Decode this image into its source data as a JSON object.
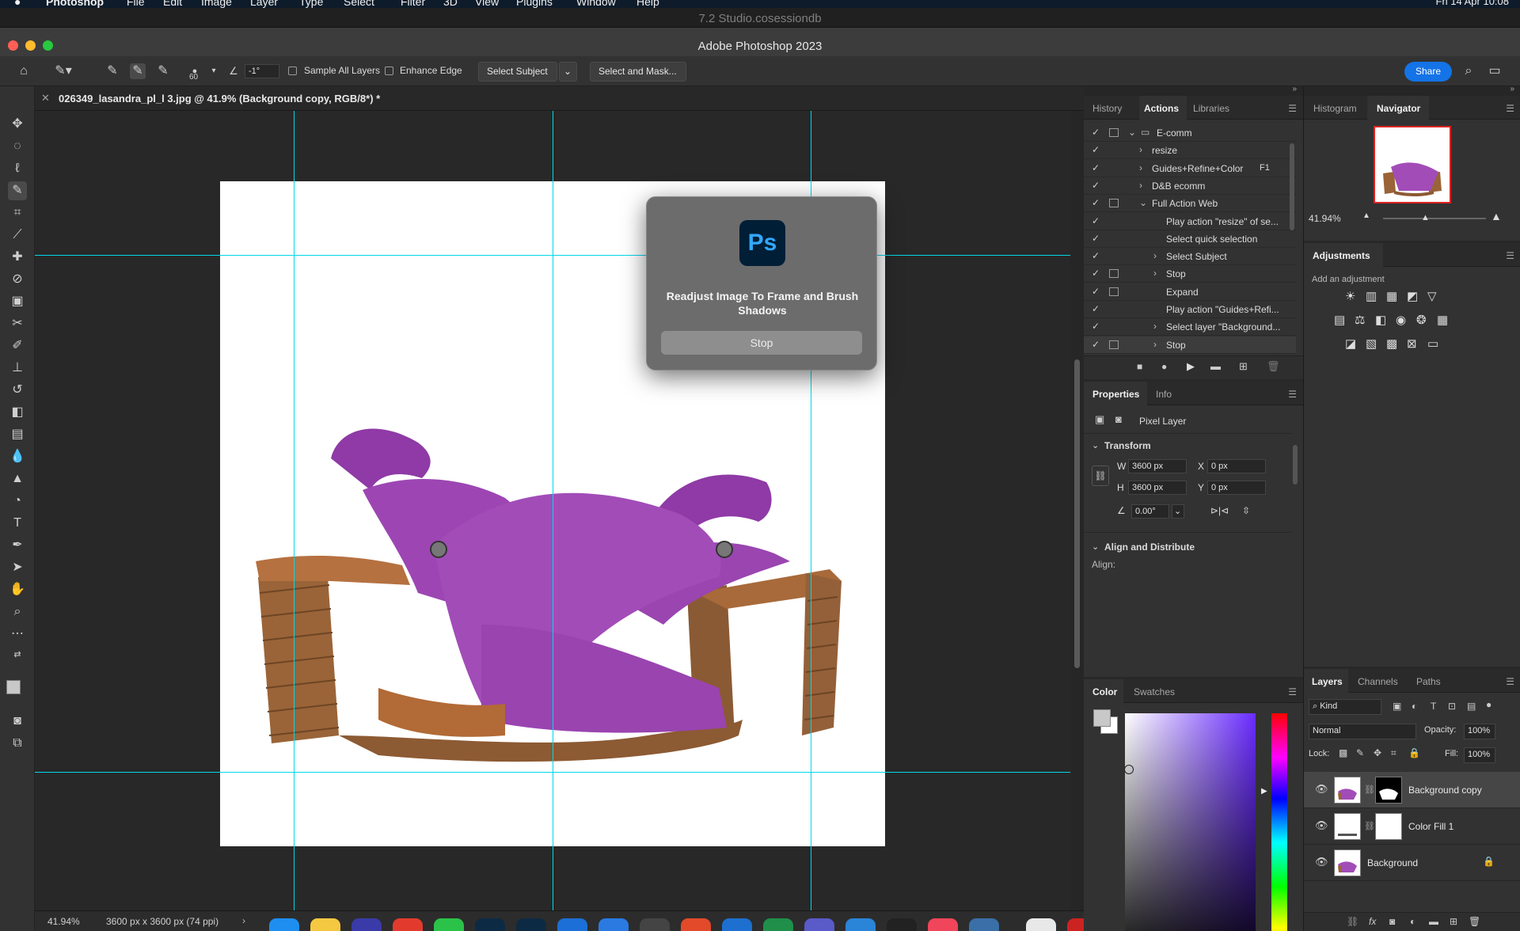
{
  "menubar": {
    "apple": "",
    "items": [
      "Photoshop",
      "File",
      "Edit",
      "Image",
      "Layer",
      "Type",
      "Select",
      "Filter",
      "3D",
      "View",
      "Plugins",
      "Window",
      "Help"
    ],
    "clock": "Fri 14 Apr 10:08"
  },
  "window": {
    "doc_session": "7.2 Studio.cosessiondb",
    "app_title": "Adobe Photoshop 2023"
  },
  "optionsbar": {
    "brush_size": "60",
    "angle": "-1°",
    "sample_all_layers": "Sample All Layers",
    "enhance_edge": "Enhance Edge",
    "select_subject": "Select Subject",
    "select_and_mask": "Select and Mask...",
    "share": "Share"
  },
  "document": {
    "tab_title": "026349_lasandra_pl_l 3.jpg @ 41.9% (Background copy, RGB/8*) *",
    "zoom": "41.94%",
    "dimensions": "3600 px x 3600 px (74 ppi)"
  },
  "dialog": {
    "logo": "Ps",
    "message": "Readjust Image To Frame and Brush Shadows",
    "stop": "Stop"
  },
  "actions_panel": {
    "tabs": [
      "History",
      "Actions",
      "Libraries"
    ],
    "active_tab": "Actions",
    "rows": [
      {
        "label": "E-comm",
        "indent": 0,
        "kind": "set",
        "expanded": true,
        "box": true
      },
      {
        "label": "resize",
        "indent": 1,
        "kind": "action",
        "expanded": false,
        "box": false
      },
      {
        "label": "Guides+Refine+Color",
        "indent": 1,
        "kind": "action",
        "expanded": false,
        "box": false,
        "shortcut": "F1"
      },
      {
        "label": "D&B ecomm",
        "indent": 1,
        "kind": "action",
        "expanded": false,
        "box": false
      },
      {
        "label": "Full Action Web",
        "indent": 1,
        "kind": "action",
        "expanded": true,
        "box": true
      },
      {
        "label": "Play action \"resize\" of se...",
        "indent": 2,
        "kind": "step",
        "box": false
      },
      {
        "label": "Select quick selection",
        "indent": 2,
        "kind": "step",
        "box": false
      },
      {
        "label": "Select Subject",
        "indent": 2,
        "kind": "step-exp",
        "box": false
      },
      {
        "label": "Stop",
        "indent": 2,
        "kind": "step-exp",
        "box": true
      },
      {
        "label": "Expand",
        "indent": 2,
        "kind": "step",
        "box": true
      },
      {
        "label": "Play action \"Guides+Refi...",
        "indent": 2,
        "kind": "step",
        "box": false
      },
      {
        "label": "Select layer \"Background...",
        "indent": 2,
        "kind": "step-exp",
        "box": false
      },
      {
        "label": "Stop",
        "indent": 2,
        "kind": "step-exp",
        "box": true,
        "highlighted": true
      }
    ]
  },
  "properties_panel": {
    "tabs": [
      "Properties",
      "Info"
    ],
    "layer_type": "Pixel Layer",
    "transform_header": "Transform",
    "w_label": "W",
    "w_value": "3600 px",
    "h_label": "H",
    "h_value": "3600 px",
    "x_label": "X",
    "x_value": "0 px",
    "y_label": "Y",
    "y_value": "0 px",
    "angle_value": "0.00°",
    "align_header": "Align and Distribute",
    "align_label": "Align:"
  },
  "color_panel": {
    "tabs": [
      "Color",
      "Swatches"
    ]
  },
  "navigator_panel": {
    "tabs": [
      "Histogram",
      "Navigator"
    ],
    "zoom": "41.94%"
  },
  "adjustments_panel": {
    "title": "Adjustments",
    "subtitle": "Add an adjustment"
  },
  "layers_panel": {
    "tabs": [
      "Layers",
      "Channels",
      "Paths"
    ],
    "kind": "Kind",
    "blend_mode": "Normal",
    "opacity_label": "Opacity:",
    "opacity": "100%",
    "lock_label": "Lock:",
    "fill_label": "Fill:",
    "fill": "100%",
    "layers": [
      {
        "name": "Background copy",
        "selected": true
      },
      {
        "name": "Color Fill 1",
        "selected": false
      },
      {
        "name": "Background",
        "selected": false,
        "locked": true
      }
    ]
  },
  "colors": {
    "accent": "#1473e6",
    "guide": "#00d8e8",
    "shoe": "#9b3fb0"
  }
}
